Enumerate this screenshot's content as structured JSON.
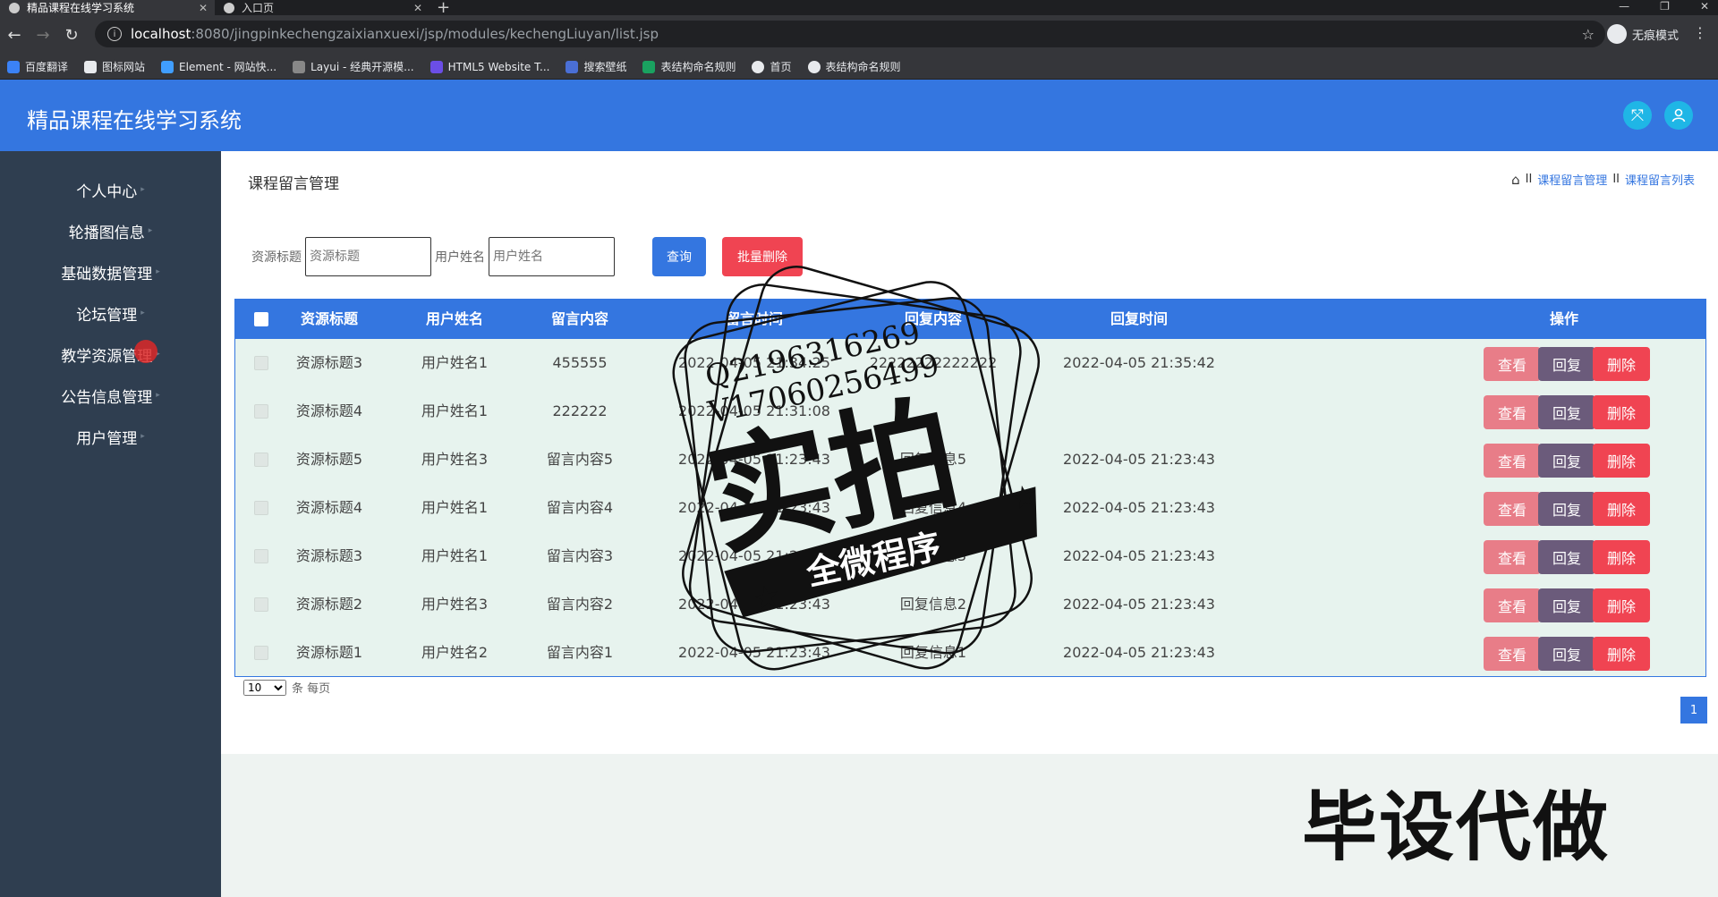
{
  "browser": {
    "tabs": [
      {
        "title": "精品课程在线学习系统",
        "active": true
      },
      {
        "title": "入口页",
        "active": false
      }
    ],
    "url_host": "localhost",
    "url_path": ":8080/jingpinkechengzaixianxuexi/jsp/modules/kechengLiuyan/list.jsp",
    "incognito_label": "无痕模式",
    "bookmarks": [
      "百度翻译",
      "图标网站",
      "Element - 网站快...",
      "Layui - 经典开源模...",
      "HTML5 Website T...",
      "搜索壁纸",
      "表结构命名规则",
      "首页",
      "表结构命名规则"
    ]
  },
  "app": {
    "title": "精品课程在线学习系统"
  },
  "sidebar": {
    "items": [
      "个人中心",
      "轮播图信息",
      "基础数据管理",
      "论坛管理",
      "教学资源管理",
      "公告信息管理",
      "用户管理"
    ]
  },
  "page": {
    "title": "课程留言管理",
    "breadcrumb": [
      "课程留言管理",
      "课程留言列表"
    ],
    "breadcrumb_sep": "II"
  },
  "search": {
    "title_label": "资源标题",
    "title_placeholder": "资源标题",
    "user_label": "用户姓名",
    "user_placeholder": "用户姓名",
    "query_button": "查询",
    "batch_delete_button": "批量删除"
  },
  "table": {
    "headers": [
      "资源标题",
      "用户姓名",
      "留言内容",
      "留言时间",
      "回复内容",
      "回复时间",
      "操作"
    ],
    "rows": [
      [
        "资源标题3",
        "用户姓名1",
        "455555",
        "2022-04-05 21:34:25",
        "22222222222222",
        "2022-04-05 21:35:42"
      ],
      [
        "资源标题4",
        "用户姓名1",
        "222222",
        "2022-04-05 21:31:08",
        "",
        ""
      ],
      [
        "资源标题5",
        "用户姓名3",
        "留言内容5",
        "2022-04-05 21:23:43",
        "回复信息5",
        "2022-04-05 21:23:43"
      ],
      [
        "资源标题4",
        "用户姓名1",
        "留言内容4",
        "2022-04-05 21:23:43",
        "回复信息4",
        "2022-04-05 21:23:43"
      ],
      [
        "资源标题3",
        "用户姓名1",
        "留言内容3",
        "2022-04-05 21:23:43",
        "回复信息3",
        "2022-04-05 21:23:43"
      ],
      [
        "资源标题2",
        "用户姓名3",
        "留言内容2",
        "2022-04-05 21:23:43",
        "回复信息2",
        "2022-04-05 21:23:43"
      ],
      [
        "资源标题1",
        "用户姓名2",
        "留言内容1",
        "2022-04-05 21:23:43",
        "回复信息1",
        "2022-04-05 21:23:43"
      ]
    ],
    "actions": [
      "查看",
      "回复",
      "删除"
    ]
  },
  "pager": {
    "page_size": "10",
    "page_size_suffix": "条 每页",
    "current_page": "1"
  },
  "overlay": {
    "stamp_line1": "Q2196316269",
    "stamp_line2": "V17060256499",
    "stamp_main": "实拍",
    "stamp_band": "全微程序",
    "bottom_text": "毕设代做"
  },
  "colors": {
    "primary": "#3476e0",
    "sidebar": "#2f3e50",
    "view_btn": "#e87d88",
    "reply_btn": "#6b5b7b",
    "delete_btn": "#f04452",
    "batch_delete": "#f04452",
    "header_icon": "#1fb6e6"
  }
}
